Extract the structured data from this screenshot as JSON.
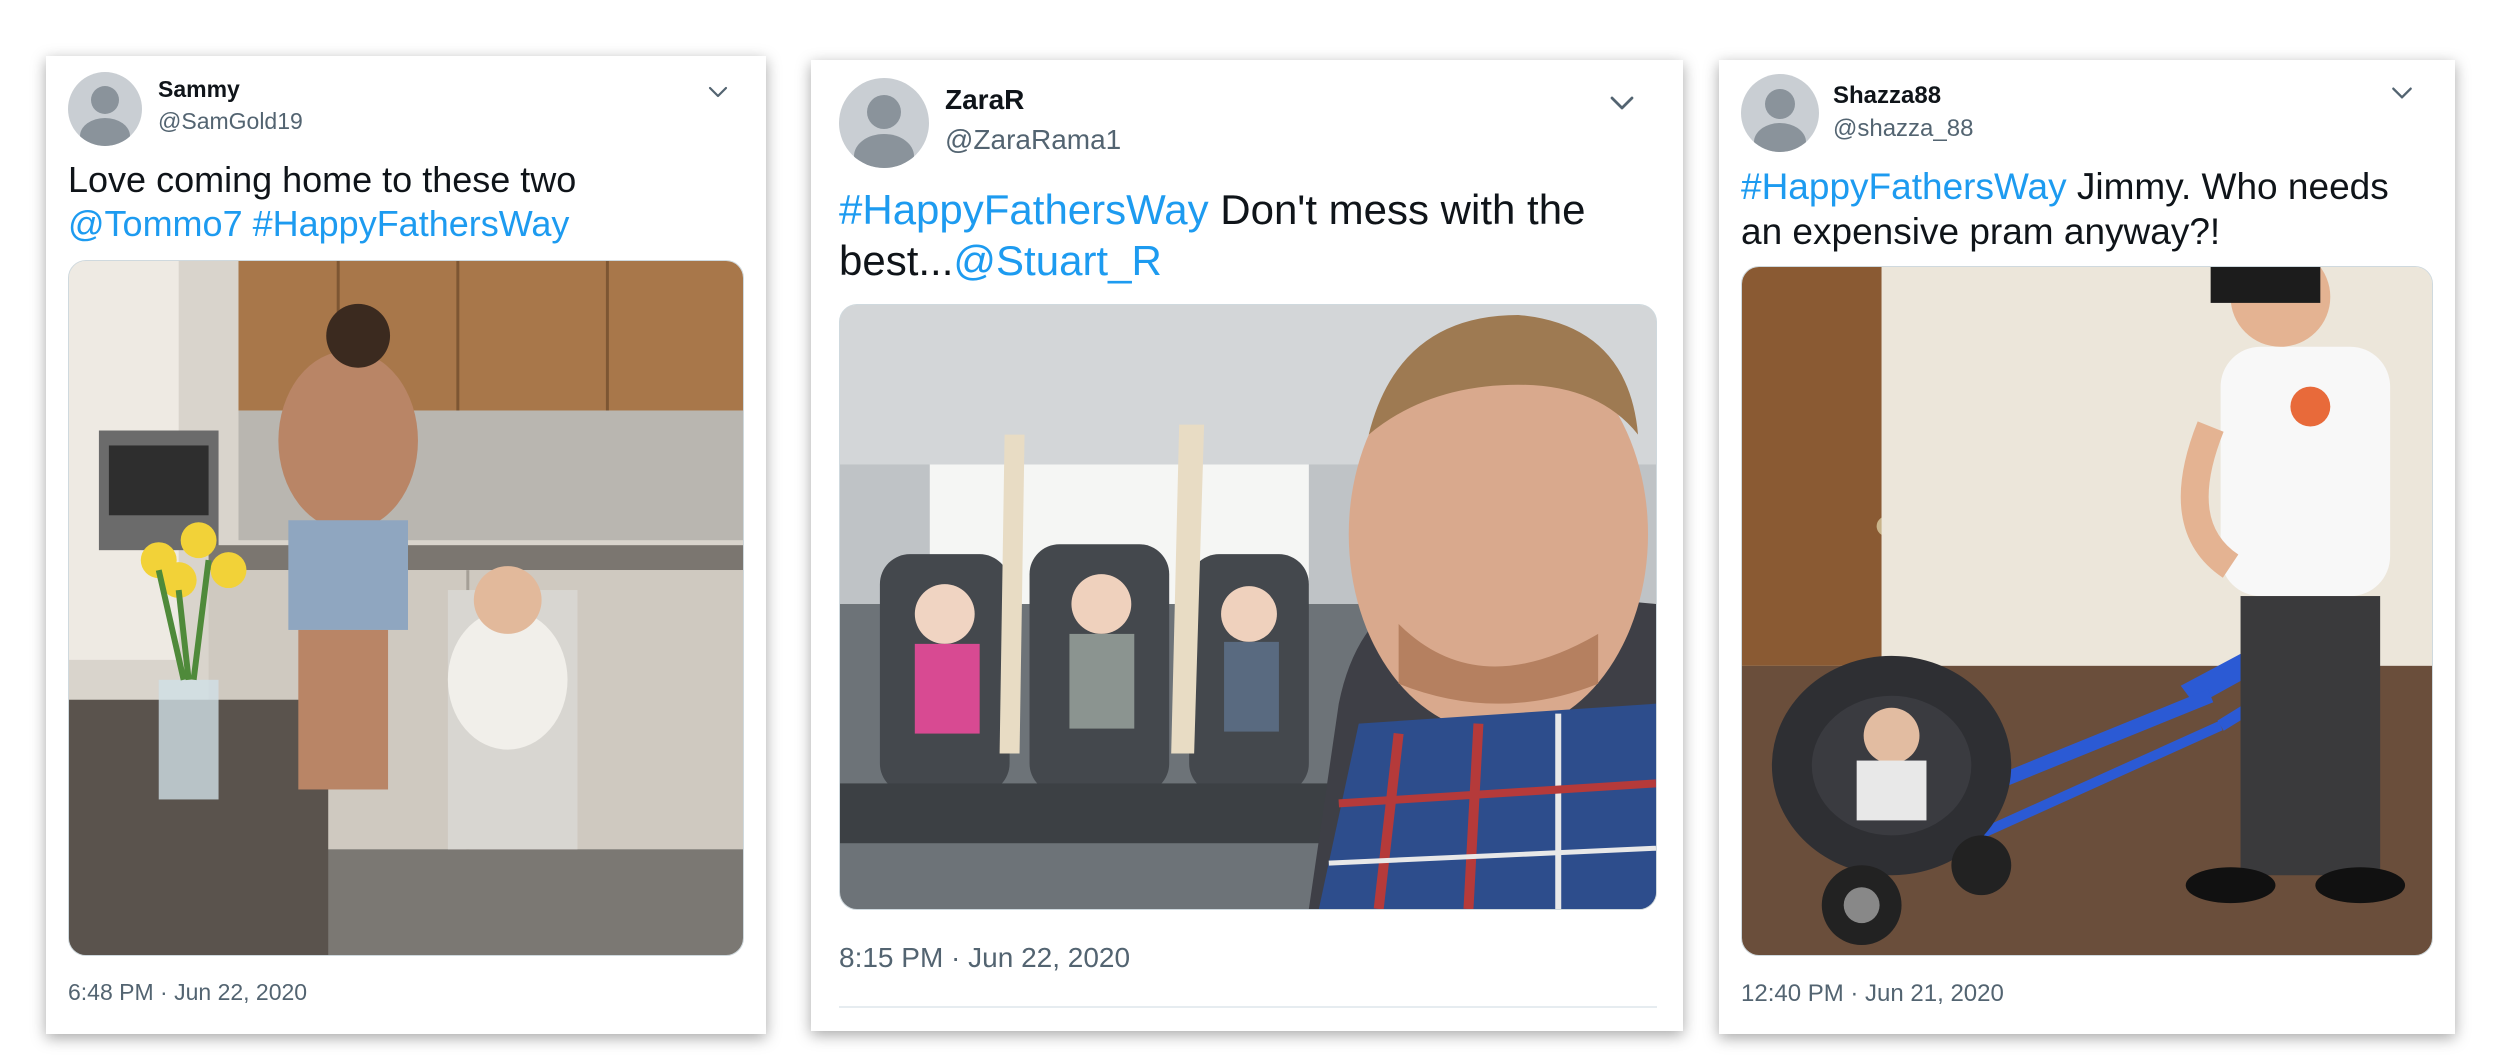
{
  "tweets": [
    {
      "display_name": "Sammy",
      "handle": "@SamGold19",
      "text_parts": {
        "plain_1": "Love coming home to these two ",
        "mention_1": "@Tommo7",
        "space_1": " ",
        "hashtag_1": "#HappyFathersWay"
      },
      "timestamp": "6:48 PM · Jun 22, 2020",
      "avatar_icon": "default-avatar-icon",
      "menu_icon": "chevron-down-icon"
    },
    {
      "display_name": "ZaraR",
      "handle": "@ZaraRama1",
      "text_parts": {
        "hashtag_1": "#HappyFathersWay",
        "plain_1": " Don't mess with the best...",
        "mention_1": "@Stuart_R"
      },
      "timestamp": "8:15 PM · Jun 22, 2020",
      "avatar_icon": "default-avatar-icon",
      "menu_icon": "chevron-down-icon"
    },
    {
      "display_name": "Shazza88",
      "handle": "@shazza_88",
      "text_parts": {
        "hashtag_1": "#HappyFathersWay",
        "plain_1": " Jimmy. Who needs an expensive pram anyway?!"
      },
      "timestamp": "12:40 PM · Jun 21, 2020",
      "avatar_icon": "default-avatar-icon",
      "menu_icon": "chevron-down-icon"
    }
  ],
  "colors": {
    "link": "#1d9bf0",
    "text": "#0f1419",
    "secondary_text": "#536471",
    "avatar_bg": "#c9ced3",
    "avatar_fg": "#8a939b"
  }
}
